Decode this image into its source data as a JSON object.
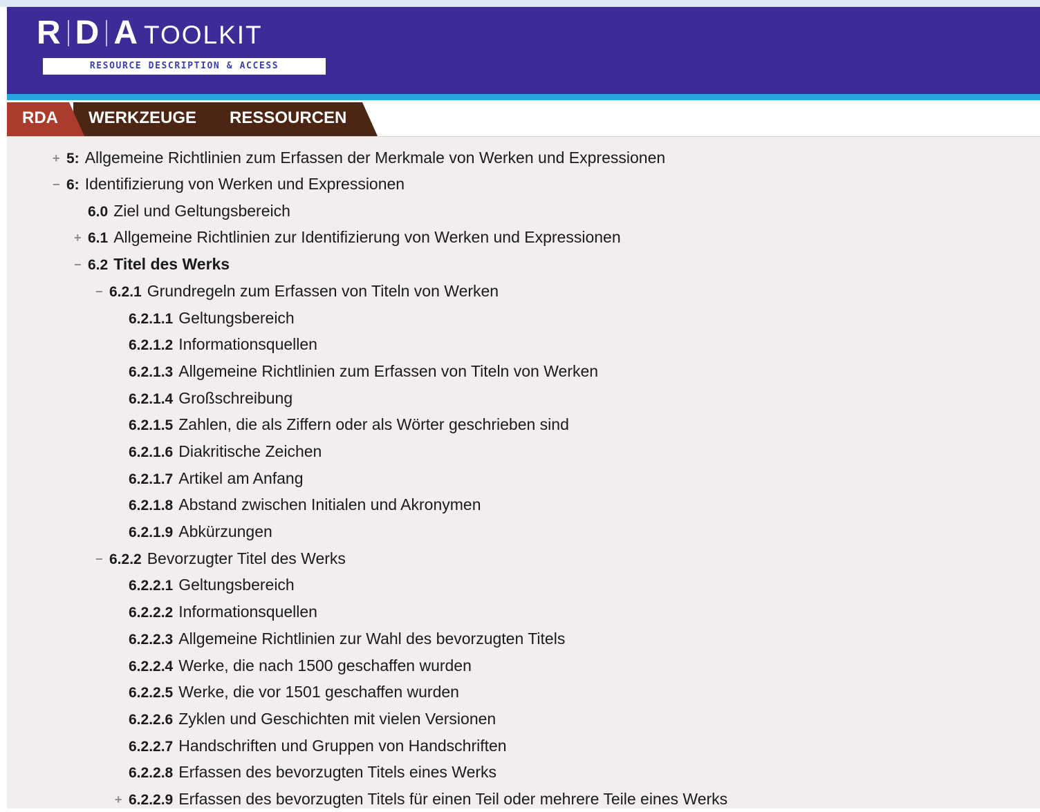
{
  "brand": {
    "logo_letters": [
      "R",
      "D",
      "A"
    ],
    "logo_word": "TOOLKIT",
    "logo_subtitle": "RESOURCE DESCRIPTION & ACCESS"
  },
  "tabs": [
    {
      "label": "RDA",
      "active": true
    },
    {
      "label": "WERKZEUGE",
      "active": false
    },
    {
      "label": "RESSOURCEN",
      "active": false
    }
  ],
  "colors": {
    "header_bg": "#3b2c98",
    "accent_bar": "#2aa6de",
    "tab_active": "#ab3b2d",
    "tab_inactive": "#4d2514",
    "content_bg": "#f2eeee"
  },
  "toc": [
    {
      "toggle": "+",
      "num": "5:",
      "title": "Allgemeine Richtlinien zum Erfassen der Merkmale von Werken und Expressionen",
      "bold": false
    },
    {
      "toggle": "−",
      "num": "6:",
      "title": "Identifizierung von Werken und Expressionen",
      "bold": false
    },
    {
      "toggle": "",
      "num": "6.0",
      "title": "Ziel und Geltungsbereich",
      "bold": false
    },
    {
      "toggle": "+",
      "num": "6.1",
      "title": "Allgemeine Richtlinien zur Identifizierung von Werken und Expressionen",
      "bold": false
    },
    {
      "toggle": "−",
      "num": "6.2",
      "title": "Titel des Werks",
      "bold": true
    },
    {
      "toggle": "−",
      "num": "6.2.1",
      "title": "Grundregeln zum Erfassen von Titeln von Werken",
      "bold": false
    },
    {
      "toggle": "",
      "num": "6.2.1.1",
      "title": "Geltungsbereich",
      "bold": false
    },
    {
      "toggle": "",
      "num": "6.2.1.2",
      "title": "Informationsquellen",
      "bold": false
    },
    {
      "toggle": "",
      "num": "6.2.1.3",
      "title": "Allgemeine Richtlinien zum Erfassen von Titeln von Werken",
      "bold": false
    },
    {
      "toggle": "",
      "num": "6.2.1.4",
      "title": "Großschreibung",
      "bold": false
    },
    {
      "toggle": "",
      "num": "6.2.1.5",
      "title": "Zahlen, die als Ziffern oder als Wörter geschrieben sind",
      "bold": false
    },
    {
      "toggle": "",
      "num": "6.2.1.6",
      "title": "Diakritische Zeichen",
      "bold": false
    },
    {
      "toggle": "",
      "num": "6.2.1.7",
      "title": "Artikel am Anfang",
      "bold": false
    },
    {
      "toggle": "",
      "num": "6.2.1.8",
      "title": "Abstand zwischen Initialen und Akronymen",
      "bold": false
    },
    {
      "toggle": "",
      "num": "6.2.1.9",
      "title": "Abkürzungen",
      "bold": false
    },
    {
      "toggle": "−",
      "num": "6.2.2",
      "title": "Bevorzugter Titel des Werks",
      "bold": false
    },
    {
      "toggle": "",
      "num": "6.2.2.1",
      "title": "Geltungsbereich",
      "bold": false
    },
    {
      "toggle": "",
      "num": "6.2.2.2",
      "title": "Informationsquellen",
      "bold": false
    },
    {
      "toggle": "",
      "num": "6.2.2.3",
      "title": "Allgemeine Richtlinien zur Wahl des bevorzugten Titels",
      "bold": false
    },
    {
      "toggle": "",
      "num": "6.2.2.4",
      "title": "Werke, die nach 1500 geschaffen wurden",
      "bold": false
    },
    {
      "toggle": "",
      "num": "6.2.2.5",
      "title": "Werke, die vor 1501 geschaffen wurden",
      "bold": false
    },
    {
      "toggle": "",
      "num": "6.2.2.6",
      "title": "Zyklen und Geschichten mit vielen Versionen",
      "bold": false
    },
    {
      "toggle": "",
      "num": "6.2.2.7",
      "title": "Handschriften und Gruppen von Handschriften",
      "bold": false
    },
    {
      "toggle": "",
      "num": "6.2.2.8",
      "title": "Erfassen des bevorzugten Titels eines Werks",
      "bold": false
    },
    {
      "toggle": "+",
      "num": "6.2.2.9",
      "title": "Erfassen des bevorzugten Titels für einen Teil oder mehrere Teile eines Werks",
      "bold": false
    }
  ]
}
